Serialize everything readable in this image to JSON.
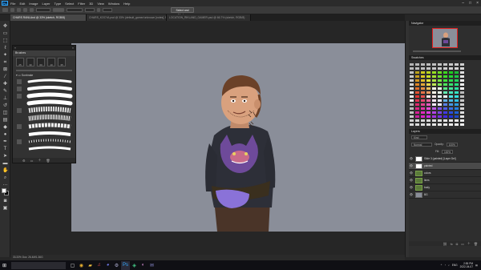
{
  "app": {
    "logo_text": "Ps",
    "menu": [
      "File",
      "Edit",
      "Image",
      "Layer",
      "Type",
      "Select",
      "Filter",
      "3D",
      "View",
      "Window",
      "Help"
    ]
  },
  "options_bar": {
    "select_mask_label": "Select and Mask..."
  },
  "document_tabs": [
    {
      "label": "CHARS RANLAnd @ 33% (sketch, RGB/8)",
      "active": true
    },
    {
      "label": "CHARS_KOCYA.psd @ 33% (default_gamer/unknown [notes], RGB/8)",
      "active": false
    },
    {
      "label": "LOCATION_RIKLAND_GAMER.psd @ 66.7% (sketch, RGB/8)",
      "active": false
    }
  ],
  "brush_panel": {
    "title": "Brushes",
    "size_presets": [
      "25",
      "30",
      "60",
      "10",
      "35"
    ],
    "folder_name": "Sunbrake"
  },
  "panels": {
    "navigator_title": "Navigator",
    "swatches_title": "Swatches",
    "layers_title": "Layers",
    "blend_mode": "Normal",
    "opacity_label": "Opacity:",
    "opacity_value": "100%",
    "fill_label": "Fill:",
    "fill_value": "100%",
    "search_kind": "Kind",
    "layers": [
      {
        "name": "Slide 3 (painted) [Layer Del]",
        "kind": "white",
        "selected": false
      },
      {
        "name": "painted",
        "kind": "white",
        "selected": true
      },
      {
        "name": "colors",
        "kind": "folder",
        "selected": false
      },
      {
        "name": "lines",
        "kind": "folder",
        "selected": false
      },
      {
        "name": "body",
        "kind": "folder",
        "selected": false
      },
      {
        "name": "BG",
        "kind": "gray",
        "selected": false
      }
    ]
  },
  "status_bar": {
    "text": "33.33%    Doc: 26.4M/1.36G"
  },
  "taskbar": {
    "time": "2:55 PM",
    "date": "2022-04-07",
    "lang": "ENG"
  }
}
